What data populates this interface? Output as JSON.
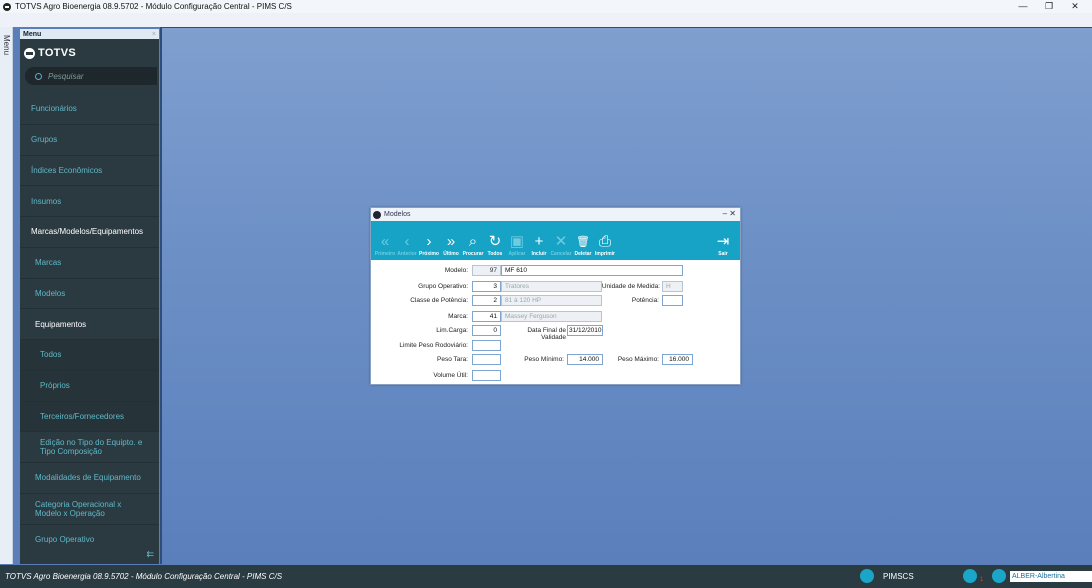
{
  "window": {
    "title": "TOTVS Agro Bioenergia 08.9.5702 - Módulo Configuração Central - PIMS C/S",
    "controls": [
      "—",
      "❐",
      "✕"
    ]
  },
  "strip": {
    "label": "Menu"
  },
  "sidebar": {
    "header": "Menu",
    "close": "×",
    "brand": "TOTVS",
    "search_placeholder": "Pesquisar",
    "items": [
      {
        "label": "Funcionários"
      },
      {
        "label": "Grupos"
      },
      {
        "label": "Índices Econômicos"
      },
      {
        "label": "Insumos"
      },
      {
        "label": "Marcas/Modelos/Equipamentos"
      },
      {
        "label": "Marcas"
      },
      {
        "label": "Modelos"
      },
      {
        "label": "Equipamentos"
      },
      {
        "label": "Todos"
      },
      {
        "label": "Próprios"
      },
      {
        "label": "Terceiros/Fornecedores"
      },
      {
        "label": "Edição no Tipo do Equipto. e Tipo Composição"
      },
      {
        "label": "Modalidades de Equipamento"
      },
      {
        "label": "Categoria Operacional x Modelo x Operação"
      },
      {
        "label": "Grupo Operativo"
      }
    ],
    "collapse_icon": "⇇"
  },
  "dialog": {
    "title": "Modelos",
    "controls": "–  ✕",
    "toolbar": [
      {
        "label": "Primeiro",
        "icon": "«"
      },
      {
        "label": "Anterior",
        "icon": "‹"
      },
      {
        "label": "Próximo",
        "icon": "›"
      },
      {
        "label": "Último",
        "icon": "»"
      },
      {
        "label": "Procurar",
        "icon": "⌕"
      },
      {
        "label": "Todos",
        "icon": "↻"
      },
      {
        "label": "Aplicar",
        "icon": "▣"
      },
      {
        "label": "Incluir",
        "icon": "+"
      },
      {
        "label": "Cancelar",
        "icon": "✕"
      },
      {
        "label": "Deletar",
        "icon": "🗑"
      },
      {
        "label": "Imprimir",
        "icon": "⎙"
      }
    ],
    "exit": {
      "label": "Sair",
      "icon": "⇥"
    },
    "form": {
      "modelo_label": "Modelo:",
      "modelo_code": "97",
      "modelo_name": "MF 610",
      "grupo_label": "Grupo Operativo:",
      "grupo_code": "3",
      "grupo_name": "Tratores",
      "unidade_label": "Unidade de Medida:",
      "unidade_value": "H",
      "classe_label": "Classe de Potência:",
      "classe_code": "2",
      "classe_name": "81 à 120 HP",
      "potencia_label": "Potência:",
      "potencia_value": "",
      "marca_label": "Marca:",
      "marca_code": "41",
      "marca_name": "Massey Ferguson",
      "limcarga_label": "Lim.Carga:",
      "limcarga_value": "0",
      "datafinal_label": "Data Final de Validade",
      "datafinal_value": "31/12/2010",
      "limite_label": "Limite Peso Rodoviário:",
      "limite_value": "",
      "pesotara_label": "Peso Tara:",
      "pesotara_value": "",
      "pesomin_label": "Peso Mínimo:",
      "pesomin_value": "14.000",
      "pesomax_label": "Peso Máximo:",
      "pesomax_value": "16.000",
      "volume_label": "Volume Útil:",
      "volume_value": ""
    }
  },
  "statusbar": {
    "text": "TOTVS Agro Bioenergia 08.9.5702 - Módulo Configuração Central - PIMS C/S",
    "user": "PIMSCS",
    "badge": "1",
    "env": "ALBER-Albertina"
  }
}
